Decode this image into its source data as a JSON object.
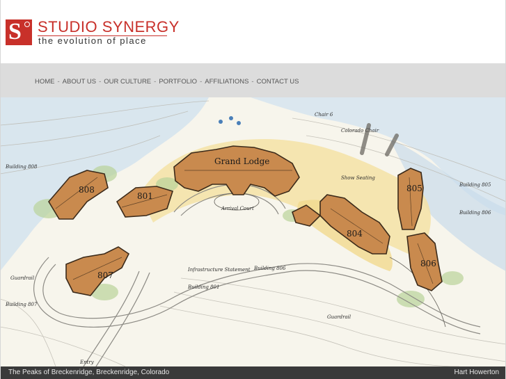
{
  "brand": {
    "logo_letter": "S",
    "name": "STUDIO SYNERGY",
    "tagline": "the evolution of place",
    "color": "#c8302a"
  },
  "nav": {
    "items": [
      {
        "label": "HOME"
      },
      {
        "label": "ABOUT US"
      },
      {
        "label": "OUR CULTURE"
      },
      {
        "label": "PORTFOLIO"
      },
      {
        "label": "AFFILIATIONS"
      },
      {
        "label": "CONTACT US"
      }
    ],
    "separator": "-"
  },
  "siteplan": {
    "buildings": {
      "b808": "808",
      "b801": "801",
      "b807": "807",
      "b804": "804",
      "b805": "805",
      "b806": "806",
      "grand_lodge": "Grand Lodge"
    },
    "notes": {
      "arrival_court": "Arrival Court",
      "chair6": "Chair 6",
      "colorado_chair": "Colorado Chair",
      "show_seating": "Show Seating",
      "building_808": "Building 808",
      "building_807": "Building 807",
      "building_805": "Building 805",
      "building_806": "Building 806",
      "building_801": "Building 801",
      "building_806b": "Building 806",
      "infrastructure": "Infrastructure Statement",
      "guardrail": "Guardrail",
      "guardrail2": "Guardrail",
      "entry": "Entry"
    }
  },
  "caption": {
    "left": "The Peaks of Breckenridge, Breckenridge, Colorado",
    "right": "Hart Howerton"
  }
}
